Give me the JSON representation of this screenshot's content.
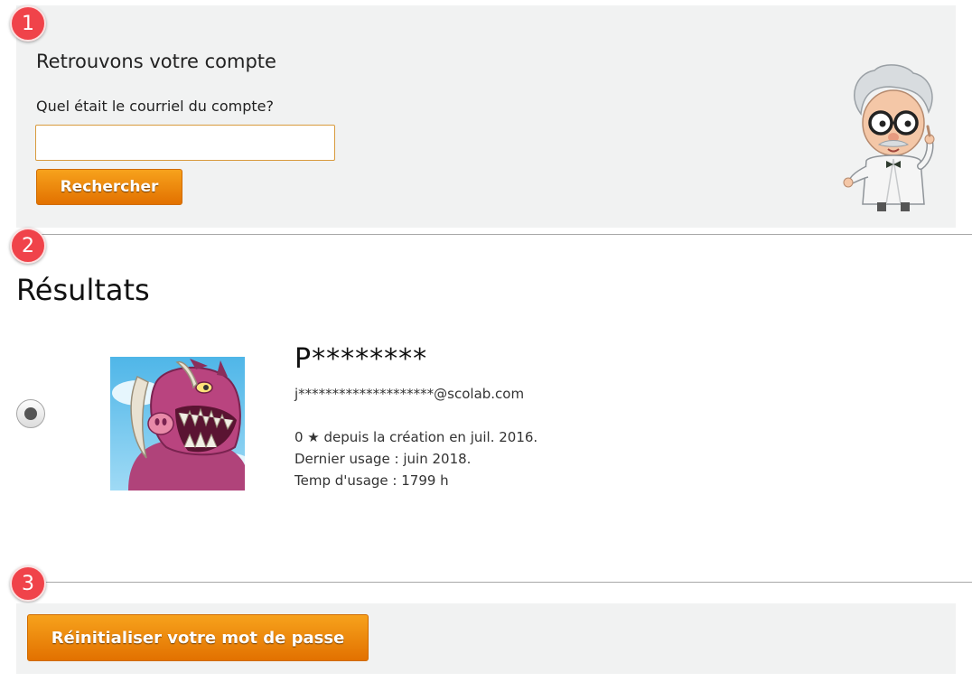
{
  "steps": [
    "1",
    "2",
    "3"
  ],
  "search": {
    "title": "Retrouvons votre compte",
    "label": "Quel était le courriel du compte?",
    "input_value": "",
    "button_label": "Rechercher"
  },
  "results": {
    "title": "Résultats",
    "account": {
      "name": "P********",
      "email": "j********************@scolab.com",
      "stars_line": "0 ★ depuis la création en juil. 2016.",
      "last_usage": "Dernier usage : juin 2018.",
      "usage_time": "Temp d'usage : 1799 h",
      "selected": true
    }
  },
  "reset": {
    "button_label": "Réinitialiser votre mot de passe"
  },
  "colors": {
    "badge": "#f0434a",
    "button_orange": "#f08a0f",
    "panel_bg": "#f1f2f2"
  }
}
